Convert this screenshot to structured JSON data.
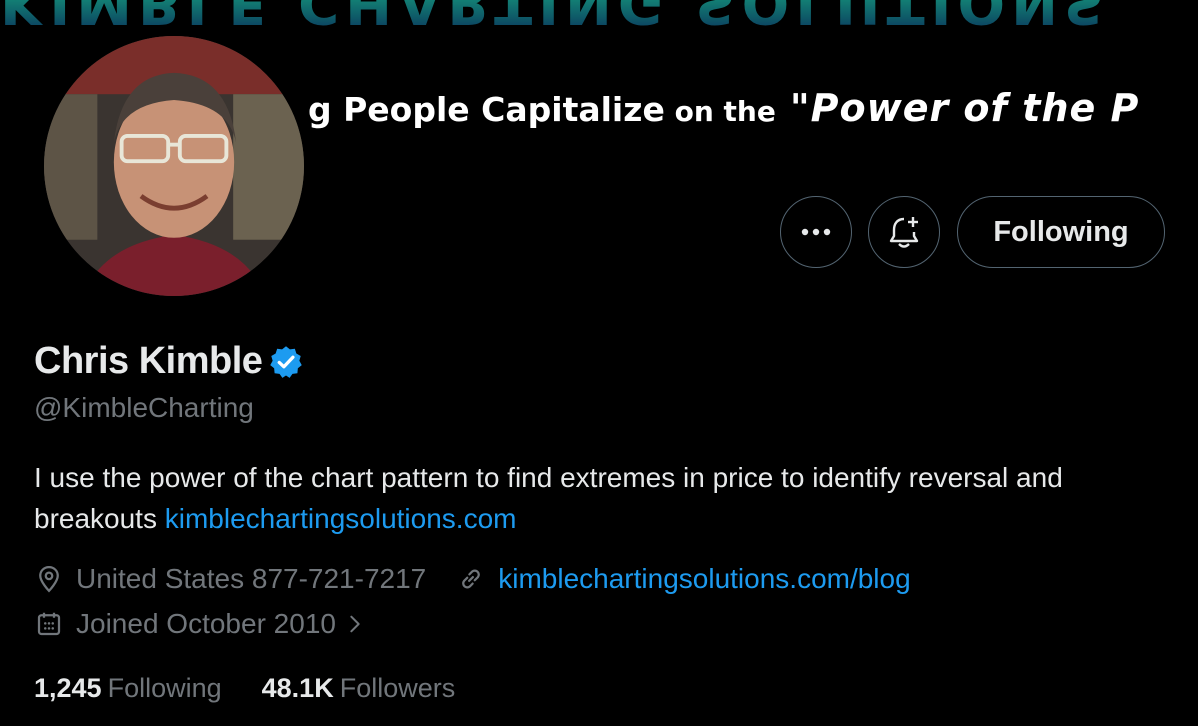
{
  "banner": {
    "top_text": "KIMBLE CHARTING SOLUTIONS",
    "slogan_part1": "g People Capitalize",
    "slogan_part2": " on the",
    "slogan_part3": "\"Power of the P"
  },
  "actions": {
    "more_icon": "more-dots-icon",
    "notify_icon": "bell-plus-icon",
    "following_label": "Following"
  },
  "profile": {
    "display_name": "Chris Kimble",
    "verified_icon": "verified-badge-icon",
    "verified_color": "#1d9bf0",
    "handle": "@KimbleCharting",
    "bio_text": "I use the power of the chart pattern to find extremes in price to identify reversal and breakouts ",
    "bio_link": "kimblechartingsolutions.com",
    "location": "United States 877-721-7217",
    "website": "kimblechartingsolutions.com/blog",
    "joined": "Joined October 2010",
    "following_count": "1,245",
    "following_label": "Following",
    "followers_count": "48.1K",
    "followers_label": "Followers"
  },
  "colors": {
    "background": "#000000",
    "text_primary": "#e7e9ea",
    "text_secondary": "#71767b",
    "link": "#1d9bf0",
    "border": "#536471"
  }
}
